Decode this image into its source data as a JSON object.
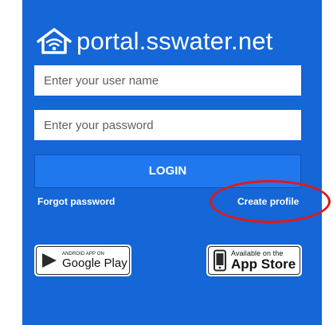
{
  "brand": {
    "title": "portal.sswater.net"
  },
  "login_form": {
    "username_placeholder": "Enter your user name",
    "password_placeholder": "Enter your password",
    "login_label": "LOGIN"
  },
  "links": {
    "forgot_password": "Forgot password",
    "create_profile": "Create profile"
  },
  "stores": {
    "google_play": {
      "small": "ANDROID APP ON",
      "big": "Google Play"
    },
    "app_store": {
      "small": "Available on the",
      "big": "App Store"
    }
  },
  "colors": {
    "panel": "#1566d6",
    "login_button": "#1f78ee",
    "annotation": "#e01a1a"
  }
}
